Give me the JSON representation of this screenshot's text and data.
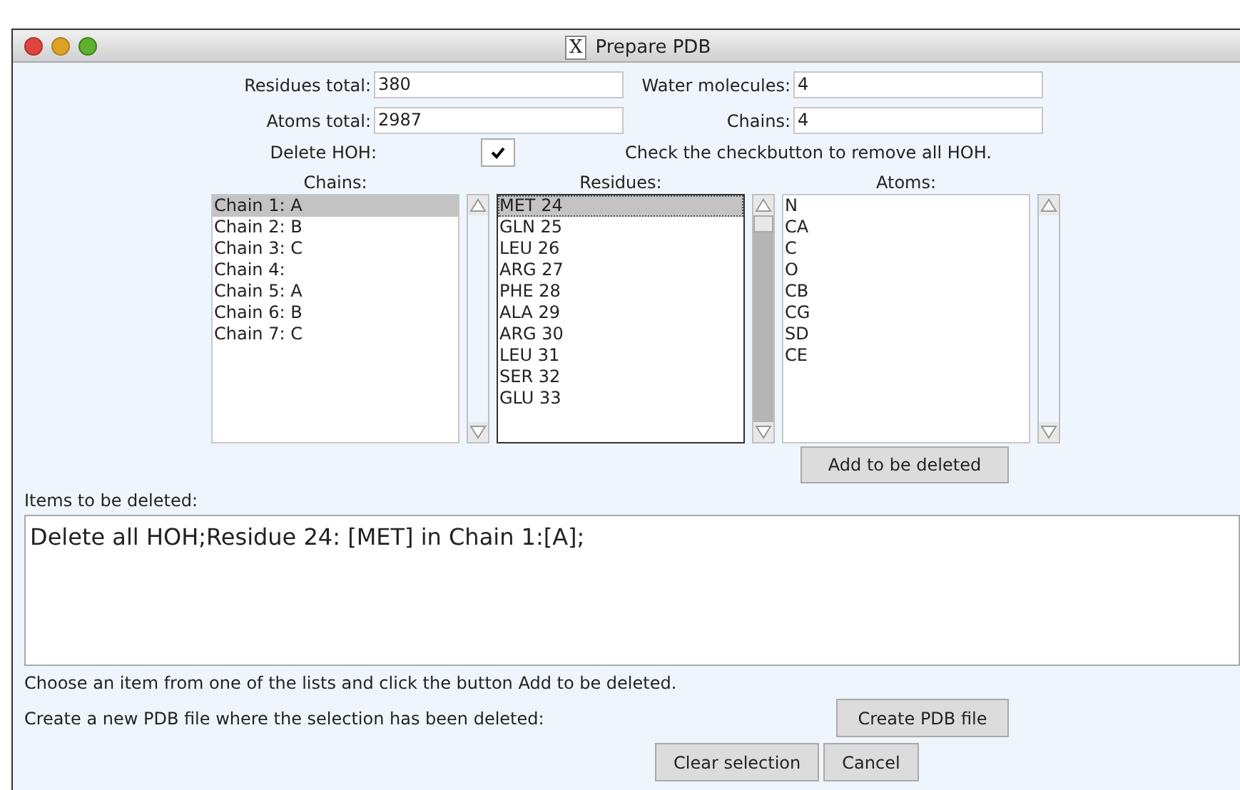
{
  "window": {
    "title": "Prepare PDB",
    "close_glyph": "X"
  },
  "fields": [
    {
      "label": "Residues total:",
      "value": "380"
    },
    {
      "label": "Water molecules:",
      "value": "4"
    },
    {
      "label": "Atoms total:",
      "value": "2987"
    },
    {
      "label": "Chains:",
      "value": "4"
    }
  ],
  "delete_hoh": {
    "label": "Delete HOH:",
    "checked": true,
    "hint": "Check the checkbutton to remove all HOH."
  },
  "lists": [
    {
      "title": "Chains:",
      "focused": false,
      "items": [
        {
          "text": "Chain 1: A",
          "selected": true
        },
        {
          "text": "Chain 2: B",
          "selected": false
        },
        {
          "text": "Chain 3: C",
          "selected": false
        },
        {
          "text": "Chain 4:",
          "selected": false
        },
        {
          "text": "Chain 5: A",
          "selected": false
        },
        {
          "text": "Chain 6: B",
          "selected": false
        },
        {
          "text": "Chain 7: C",
          "selected": false
        }
      ]
    },
    {
      "title": "Residues:",
      "focused": true,
      "items": [
        {
          "text": "MET 24",
          "selected": true
        },
        {
          "text": "GLN 25",
          "selected": false
        },
        {
          "text": "LEU 26",
          "selected": false
        },
        {
          "text": "ARG 27",
          "selected": false
        },
        {
          "text": "PHE 28",
          "selected": false
        },
        {
          "text": "ALA 29",
          "selected": false
        },
        {
          "text": "ARG 30",
          "selected": false
        },
        {
          "text": "LEU 31",
          "selected": false
        },
        {
          "text": "SER 32",
          "selected": false
        },
        {
          "text": "GLU 33",
          "selected": false
        }
      ]
    },
    {
      "title": "Atoms:",
      "focused": false,
      "items": [
        {
          "text": "N",
          "selected": false
        },
        {
          "text": "CA",
          "selected": false
        },
        {
          "text": "C",
          "selected": false
        },
        {
          "text": "O",
          "selected": false
        },
        {
          "text": "CB",
          "selected": false
        },
        {
          "text": "CG",
          "selected": false
        },
        {
          "text": "SD",
          "selected": false
        },
        {
          "text": "CE",
          "selected": false
        }
      ]
    }
  ],
  "add_button": "Add to be deleted",
  "items_label": "Items to be deleted:",
  "items_text": "Delete all HOH;Residue 24: [MET] in Chain 1:[A];",
  "instruction": "Choose an item from one of the lists and click the button Add to be deleted.",
  "create_label": "Create a new PDB file where the selection has been deleted:",
  "create_button": "Create PDB file",
  "bottom_buttons": [
    "Clear selection",
    "Cancel"
  ]
}
